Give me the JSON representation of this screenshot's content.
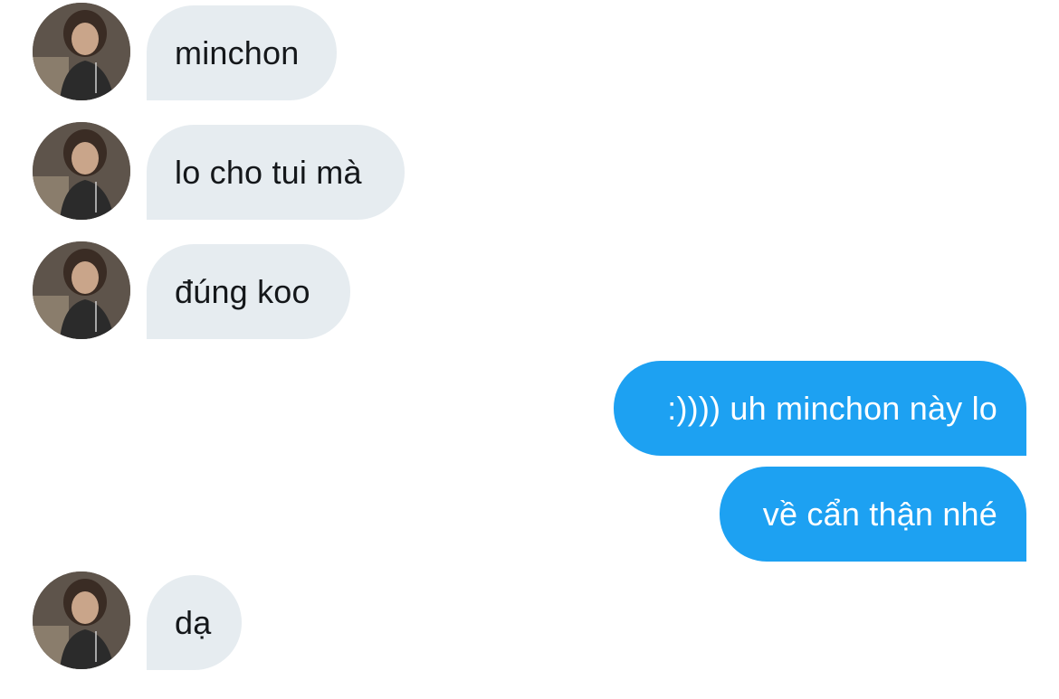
{
  "conversation": {
    "messages": [
      {
        "sender": "other",
        "text": "minchon"
      },
      {
        "sender": "other",
        "text": "lo cho tui mà"
      },
      {
        "sender": "other",
        "text": "đúng koo"
      },
      {
        "sender": "me",
        "text": ":)))) uh minchon này lo"
      },
      {
        "sender": "me",
        "text": "về cẩn thận nhé"
      },
      {
        "sender": "other",
        "text": "dạ"
      }
    ],
    "avatar_icon": "user-photo-avatar"
  },
  "colors": {
    "incoming_bubble": "#e6ecf0",
    "incoming_text": "#14171a",
    "outgoing_bubble": "#1da1f2",
    "outgoing_text": "#ffffff"
  }
}
